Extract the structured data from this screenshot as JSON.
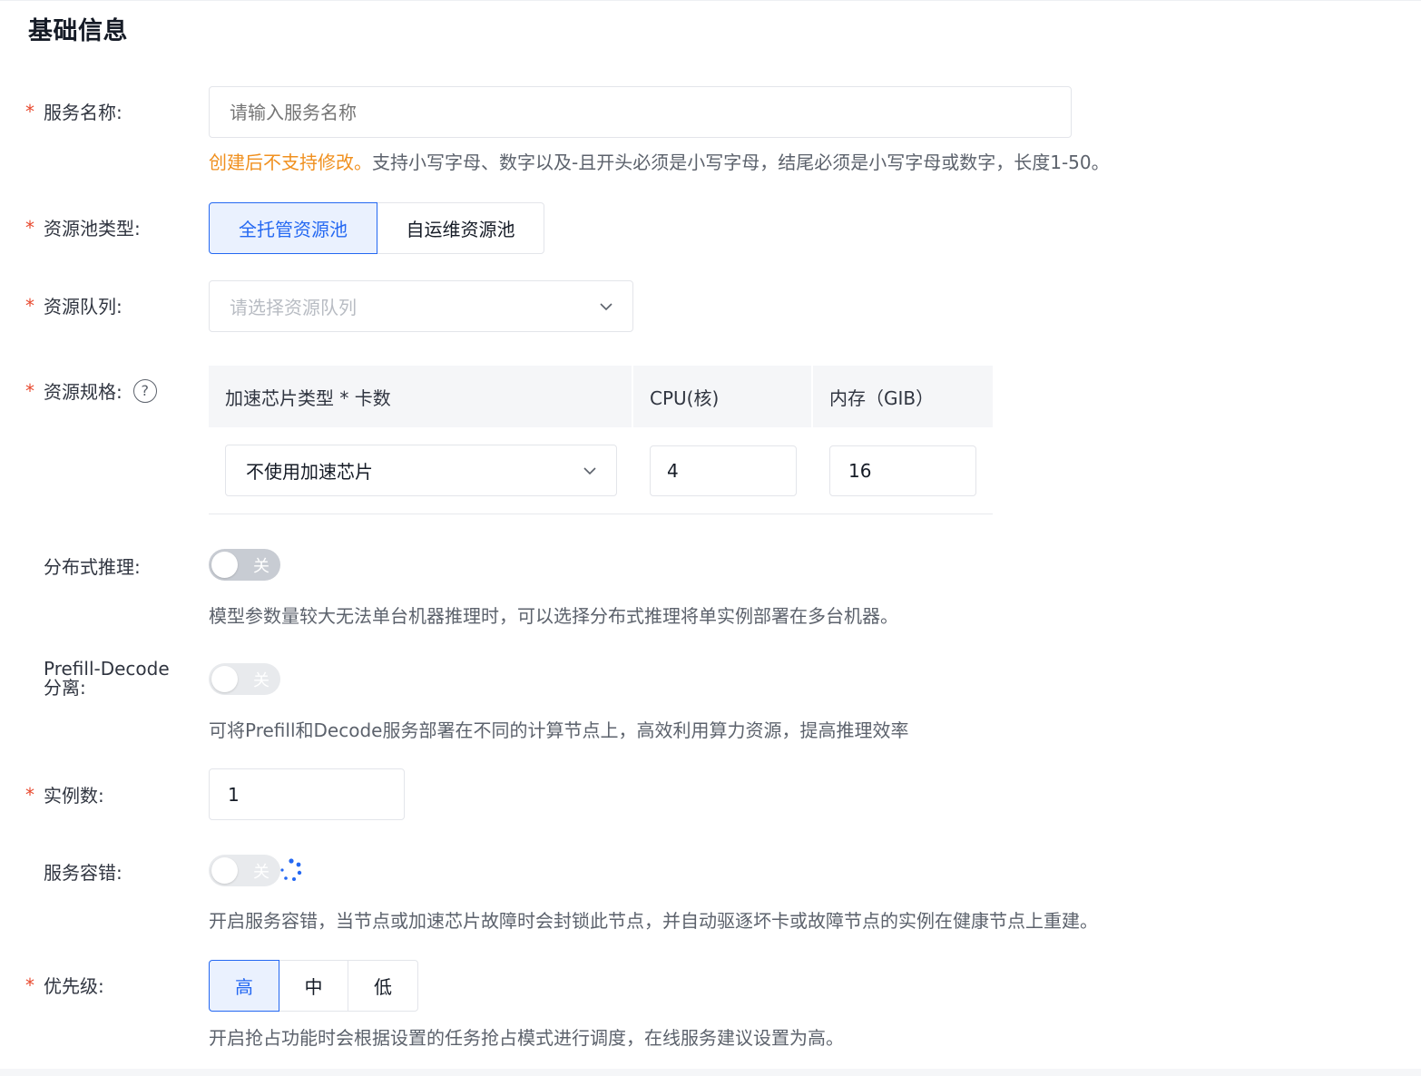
{
  "section": {
    "title": "基础信息"
  },
  "service_name": {
    "label": "服务名称:",
    "placeholder": "请输入服务名称",
    "hint_warn": "创建后不支持修改。",
    "hint_rest": "支持小写字母、数字以及-且开头必须是小写字母，结尾必须是小写字母或数字，长度1-50。"
  },
  "pool_type": {
    "label": "资源池类型:",
    "options": [
      "全托管资源池",
      "自运维资源池"
    ],
    "selected": "全托管资源池"
  },
  "queue": {
    "label": "资源队列:",
    "placeholder": "请选择资源队列"
  },
  "spec": {
    "label": "资源规格:",
    "help_glyph": "?",
    "headers": [
      "加速芯片类型 * 卡数",
      "CPU(核)",
      "内存（GIB）"
    ],
    "chip": "不使用加速芯片",
    "cpu": "4",
    "memory": "16"
  },
  "distributed": {
    "label": "分布式推理:",
    "state": "关",
    "hint": "模型参数量较大无法单台机器推理时，可以选择分布式推理将单实例部署在多台机器。"
  },
  "pd_split": {
    "label_line1": "Prefill-Decode",
    "label_line2": "分离:",
    "state": "关",
    "hint": "可将Prefill和Decode服务部署在不同的计算节点上，高效利用算力资源，提高推理效率"
  },
  "instances": {
    "label": "实例数:",
    "value": "1"
  },
  "fault_tolerance": {
    "label": "服务容错:",
    "state": "关",
    "hint": "开启服务容错，当节点或加速芯片故障时会封锁此节点，并自动驱逐坏卡或故障节点的实例在健康节点上重建。"
  },
  "priority": {
    "label": "优先级:",
    "options": [
      "高",
      "中",
      "低"
    ],
    "selected": "高",
    "hint": "开启抢占功能时会根据设置的任务抢占模式进行调度，在线服务建议设置为高。"
  },
  "icons": {
    "queue_arrow": "chevron-down-icon",
    "chip_arrow": "chevron-down-icon",
    "help": "question-circle-icon",
    "loading": "loading-spinner-icon"
  },
  "colors": {
    "accent": "#2468f2",
    "required": "#e8492e",
    "warning": "#f0901f",
    "toggle_off": "#c8ccd3"
  }
}
